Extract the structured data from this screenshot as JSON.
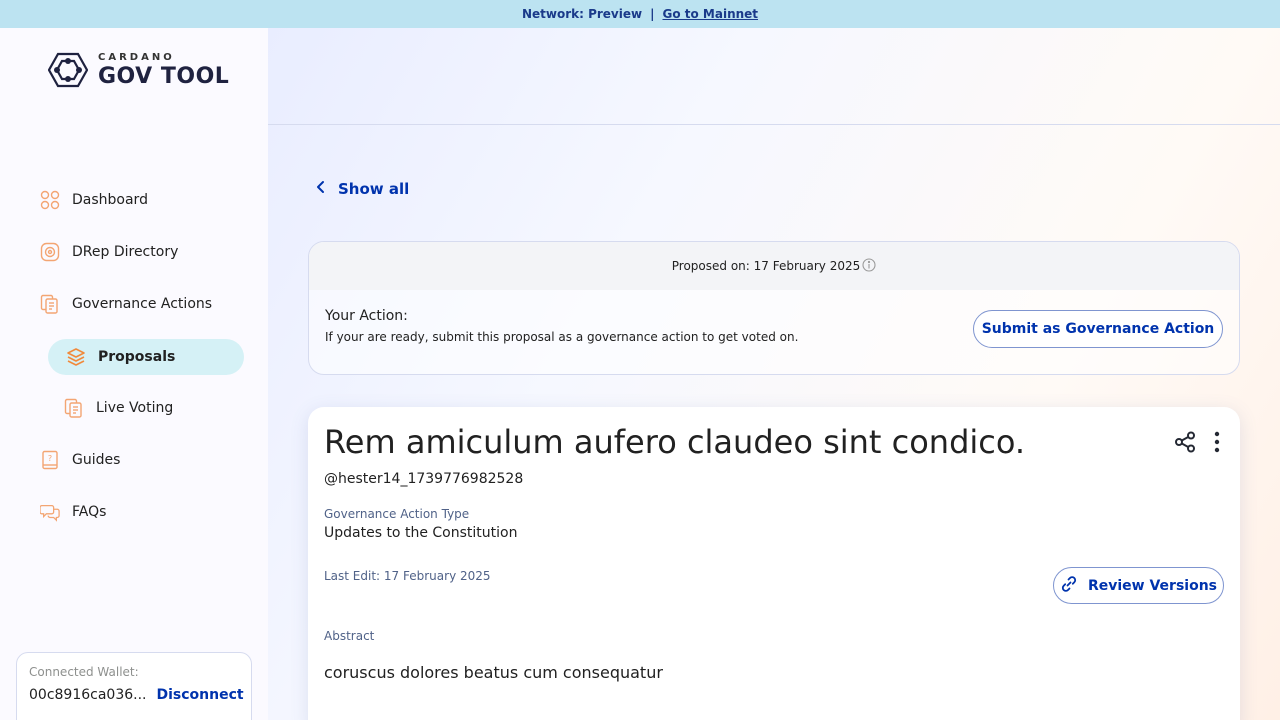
{
  "banner": {
    "network": "Network: Preview",
    "separator": "|",
    "link": "Go to Mainnet"
  },
  "logo": {
    "small": "CARDANO",
    "big": "GOV TOOL"
  },
  "nav": {
    "dashboard": "Dashboard",
    "drep_directory": "DRep Directory",
    "governance_actions": "Governance Actions",
    "proposals": "Proposals",
    "live_voting": "Live Voting",
    "guides": "Guides",
    "faqs": "FAQs"
  },
  "wallet": {
    "label": "Connected Wallet:",
    "address": "00c8916ca036...",
    "disconnect": "Disconnect"
  },
  "back": {
    "label": "Show all"
  },
  "action_card": {
    "proposed_on": "Proposed on: 17 February 2025",
    "title": "Your Action:",
    "description": "If your are ready, submit this proposal as a governance action to get voted on.",
    "submit_button": "Submit as Governance Action"
  },
  "proposal": {
    "title": "Rem amiculum aufero claudeo sint condico.",
    "username": "@hester14_1739776982528",
    "type_label": "Governance Action Type",
    "type_value": "Updates to the Constitution",
    "last_edit": "Last Edit: 17 February 2025",
    "review_button": "Review Versions",
    "abstract_label": "Abstract",
    "abstract_text": "coruscus dolores beatus cum consequatur"
  },
  "colors": {
    "primary": "#0033ad",
    "active_nav": "#d5f1f6",
    "banner": "#bce3f1",
    "icon_orange": "#f3a573"
  }
}
